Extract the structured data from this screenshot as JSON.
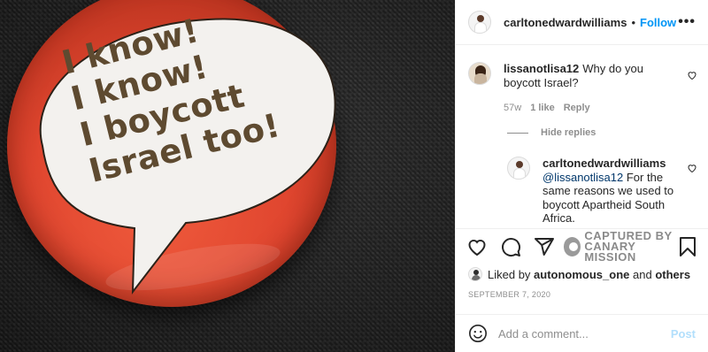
{
  "photo": {
    "pin_text_lines": [
      "I know!",
      "I know!",
      "I boycott",
      "Israel too!"
    ],
    "colors": {
      "pin_red": "#e0462f",
      "bubble_white": "#f3f1ee",
      "text_brown": "#5e4a30",
      "background_fabric": "#222222"
    }
  },
  "header": {
    "username": "carltonedwardwilliams",
    "separator": "•",
    "follow_label": "Follow",
    "more_icon": "more-horizontal-icon"
  },
  "comments": [
    {
      "user": "lissanotlisa12",
      "text": "Why do you boycott Israel?",
      "age": "57w",
      "likes": "1 like",
      "reply_label": "Reply"
    }
  ],
  "hide_replies_label": "Hide replies",
  "reply": {
    "user": "carltonedwardwilliams",
    "mention": "@lissanotlisa12",
    "text": " For the same reasons we used to boycott Apartheid South Africa."
  },
  "actions": {
    "icons": [
      "heart-icon",
      "comment-icon",
      "share-icon",
      "bookmark-icon"
    ],
    "watermark_line1": "CAPTURED BY",
    "watermark_line2": "CANARY MISSION"
  },
  "likes": {
    "prefix": "Liked by ",
    "user": "autonomous_one",
    "middle": " and ",
    "others": "others"
  },
  "date": "SEPTEMBER 7, 2020",
  "add_comment": {
    "placeholder": "Add a comment...",
    "post_label": "Post"
  },
  "colors": {
    "link_blue": "#0095f6",
    "post_disabled": "#b2dffc",
    "muted": "#8e8e8e"
  }
}
